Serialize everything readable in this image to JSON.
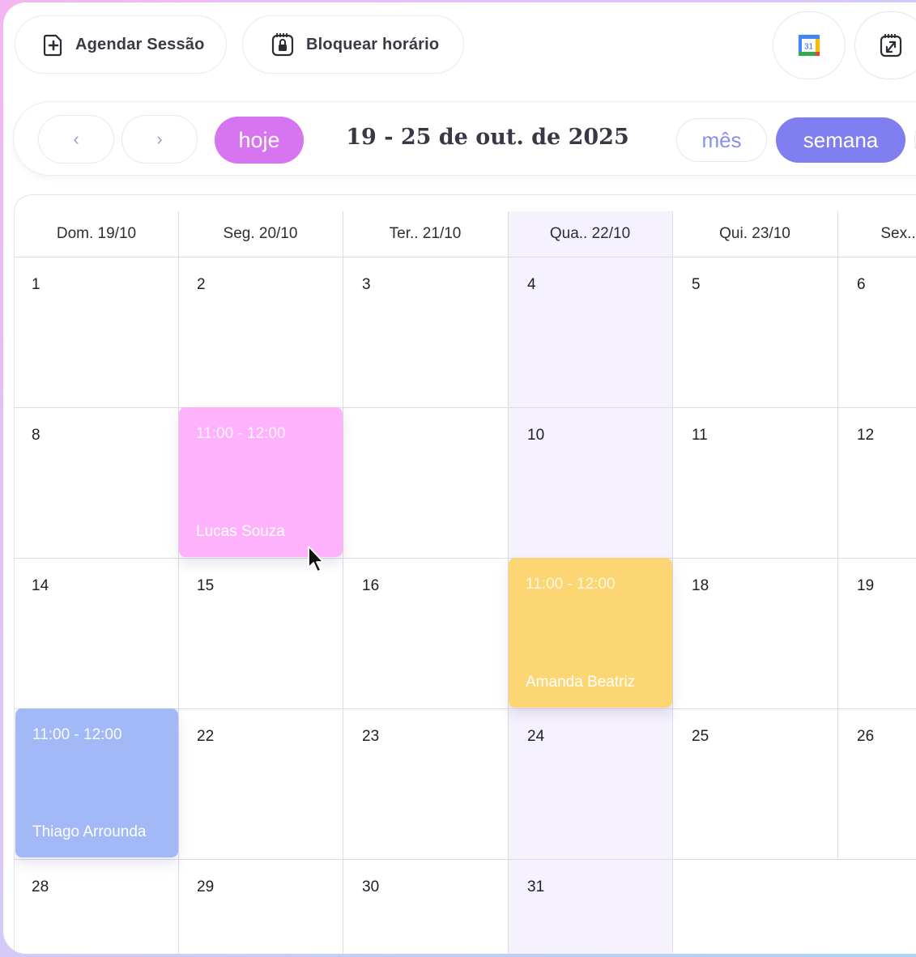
{
  "toolbar": {
    "schedule_label": "Agendar Sessão",
    "block_label": "Bloquear horário",
    "gcal_number": "31"
  },
  "nav": {
    "prev": "‹",
    "next": "›",
    "today": "hoje",
    "range_title": "19 - 25 de out. de 2025",
    "view_month": "mês",
    "view_week": "semana"
  },
  "calendar": {
    "headers": [
      "Dom. 19/10",
      "Seg. 20/10",
      "Ter.. 21/10",
      "Qua.. 22/10",
      "Qui. 23/10",
      "Sex.."
    ],
    "highlighted_column": "Qua.. 22/10",
    "rows": [
      [
        "1",
        "2",
        "3",
        "4",
        "5",
        "6"
      ],
      [
        "8",
        "",
        "",
        "10",
        "11",
        "12"
      ],
      [
        "14",
        "15",
        "16",
        "",
        "18",
        "19"
      ],
      [
        "",
        "22",
        "23",
        "24",
        "25",
        "26"
      ],
      [
        "28",
        "29",
        "30",
        "31",
        "",
        ""
      ]
    ],
    "events": [
      {
        "time": "11:00 - 12:00",
        "name": "Lucas Souza",
        "color": "#feb2fb"
      },
      {
        "time": "11:00 - 12:00",
        "name": "Amanda Beatriz",
        "color": "#fcd673"
      },
      {
        "time": "11:00 - 12:00",
        "name": "Thiago Arrounda",
        "color": "#a2b8f7"
      }
    ]
  },
  "colors": {
    "today_button": "#d774f0",
    "week_button": "#7f7ff1",
    "month_text": "#8b8fe8",
    "highlight_column": "#f5f1fd"
  }
}
